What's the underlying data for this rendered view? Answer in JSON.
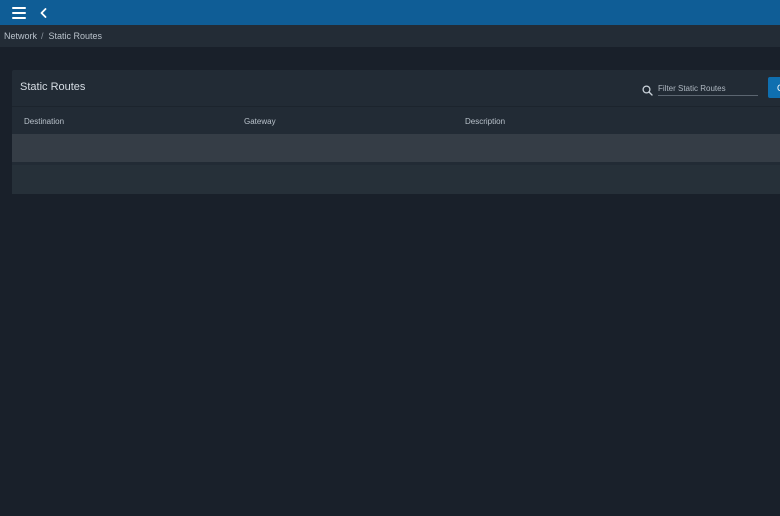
{
  "breadcrumb": {
    "items": [
      "Network",
      "Static Routes"
    ],
    "separator": "/"
  },
  "card": {
    "title": "Static Routes",
    "search": {
      "placeholder": "Filter Static Routes",
      "value": ""
    },
    "action_button_label": "C"
  },
  "table": {
    "columns": [
      "Destination",
      "Gateway",
      "Description"
    ],
    "rows": [
      {
        "destination": "",
        "gateway": "",
        "description": ""
      },
      {
        "destination": "",
        "gateway": "",
        "description": ""
      }
    ]
  },
  "icons": {
    "menu": "hamburger-menu-icon",
    "back": "chevron-left-icon",
    "search": "search-icon"
  },
  "colors": {
    "topbar": "#0f5d96",
    "background": "#19202a",
    "card": "#222b35",
    "accent": "#0f6fb0"
  }
}
